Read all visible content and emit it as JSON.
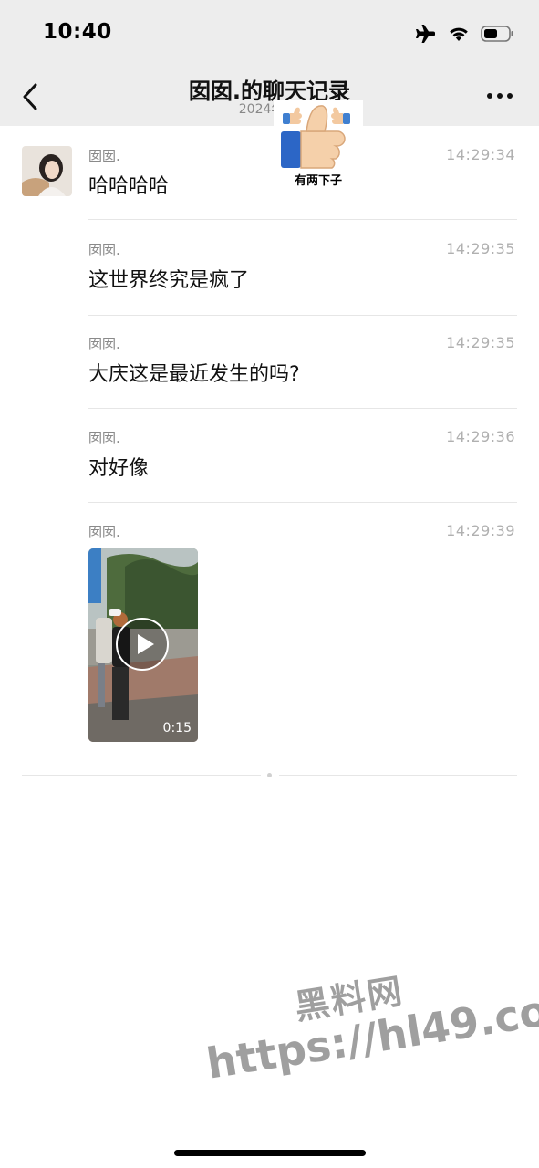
{
  "status_bar": {
    "time": "10:40",
    "icons": [
      "airplane-icon",
      "wifi-icon",
      "battery-icon"
    ]
  },
  "nav": {
    "title": "囡囡.的聊天记录",
    "subtitle": "2024年04",
    "back_icon": "chevron-left-icon",
    "more_icon": "more-dots-icon"
  },
  "sticker": {
    "text": "有两下子",
    "icon": "thumbs-up-icon"
  },
  "messages": [
    {
      "name": "囡囡.",
      "time": "14:29:34",
      "text": "哈哈哈哈",
      "avatar": true
    },
    {
      "name": "囡囡.",
      "time": "14:29:35",
      "text": "这世界终究是疯了"
    },
    {
      "name": "囡囡.",
      "time": "14:29:35",
      "text": "大庆这是最近发生的吗?"
    },
    {
      "name": "囡囡.",
      "time": "14:29:36",
      "text": "对好像"
    },
    {
      "name": "囡囡.",
      "time": "14:29:39",
      "video": {
        "duration": "0:15"
      }
    }
  ],
  "watermark": {
    "line1": "黑料网",
    "line2": "https://hl49.co"
  },
  "colors": {
    "bar_bg": "#ededed",
    "meta_gray": "#8a8a8a",
    "time_gray": "#b0b0b0"
  }
}
